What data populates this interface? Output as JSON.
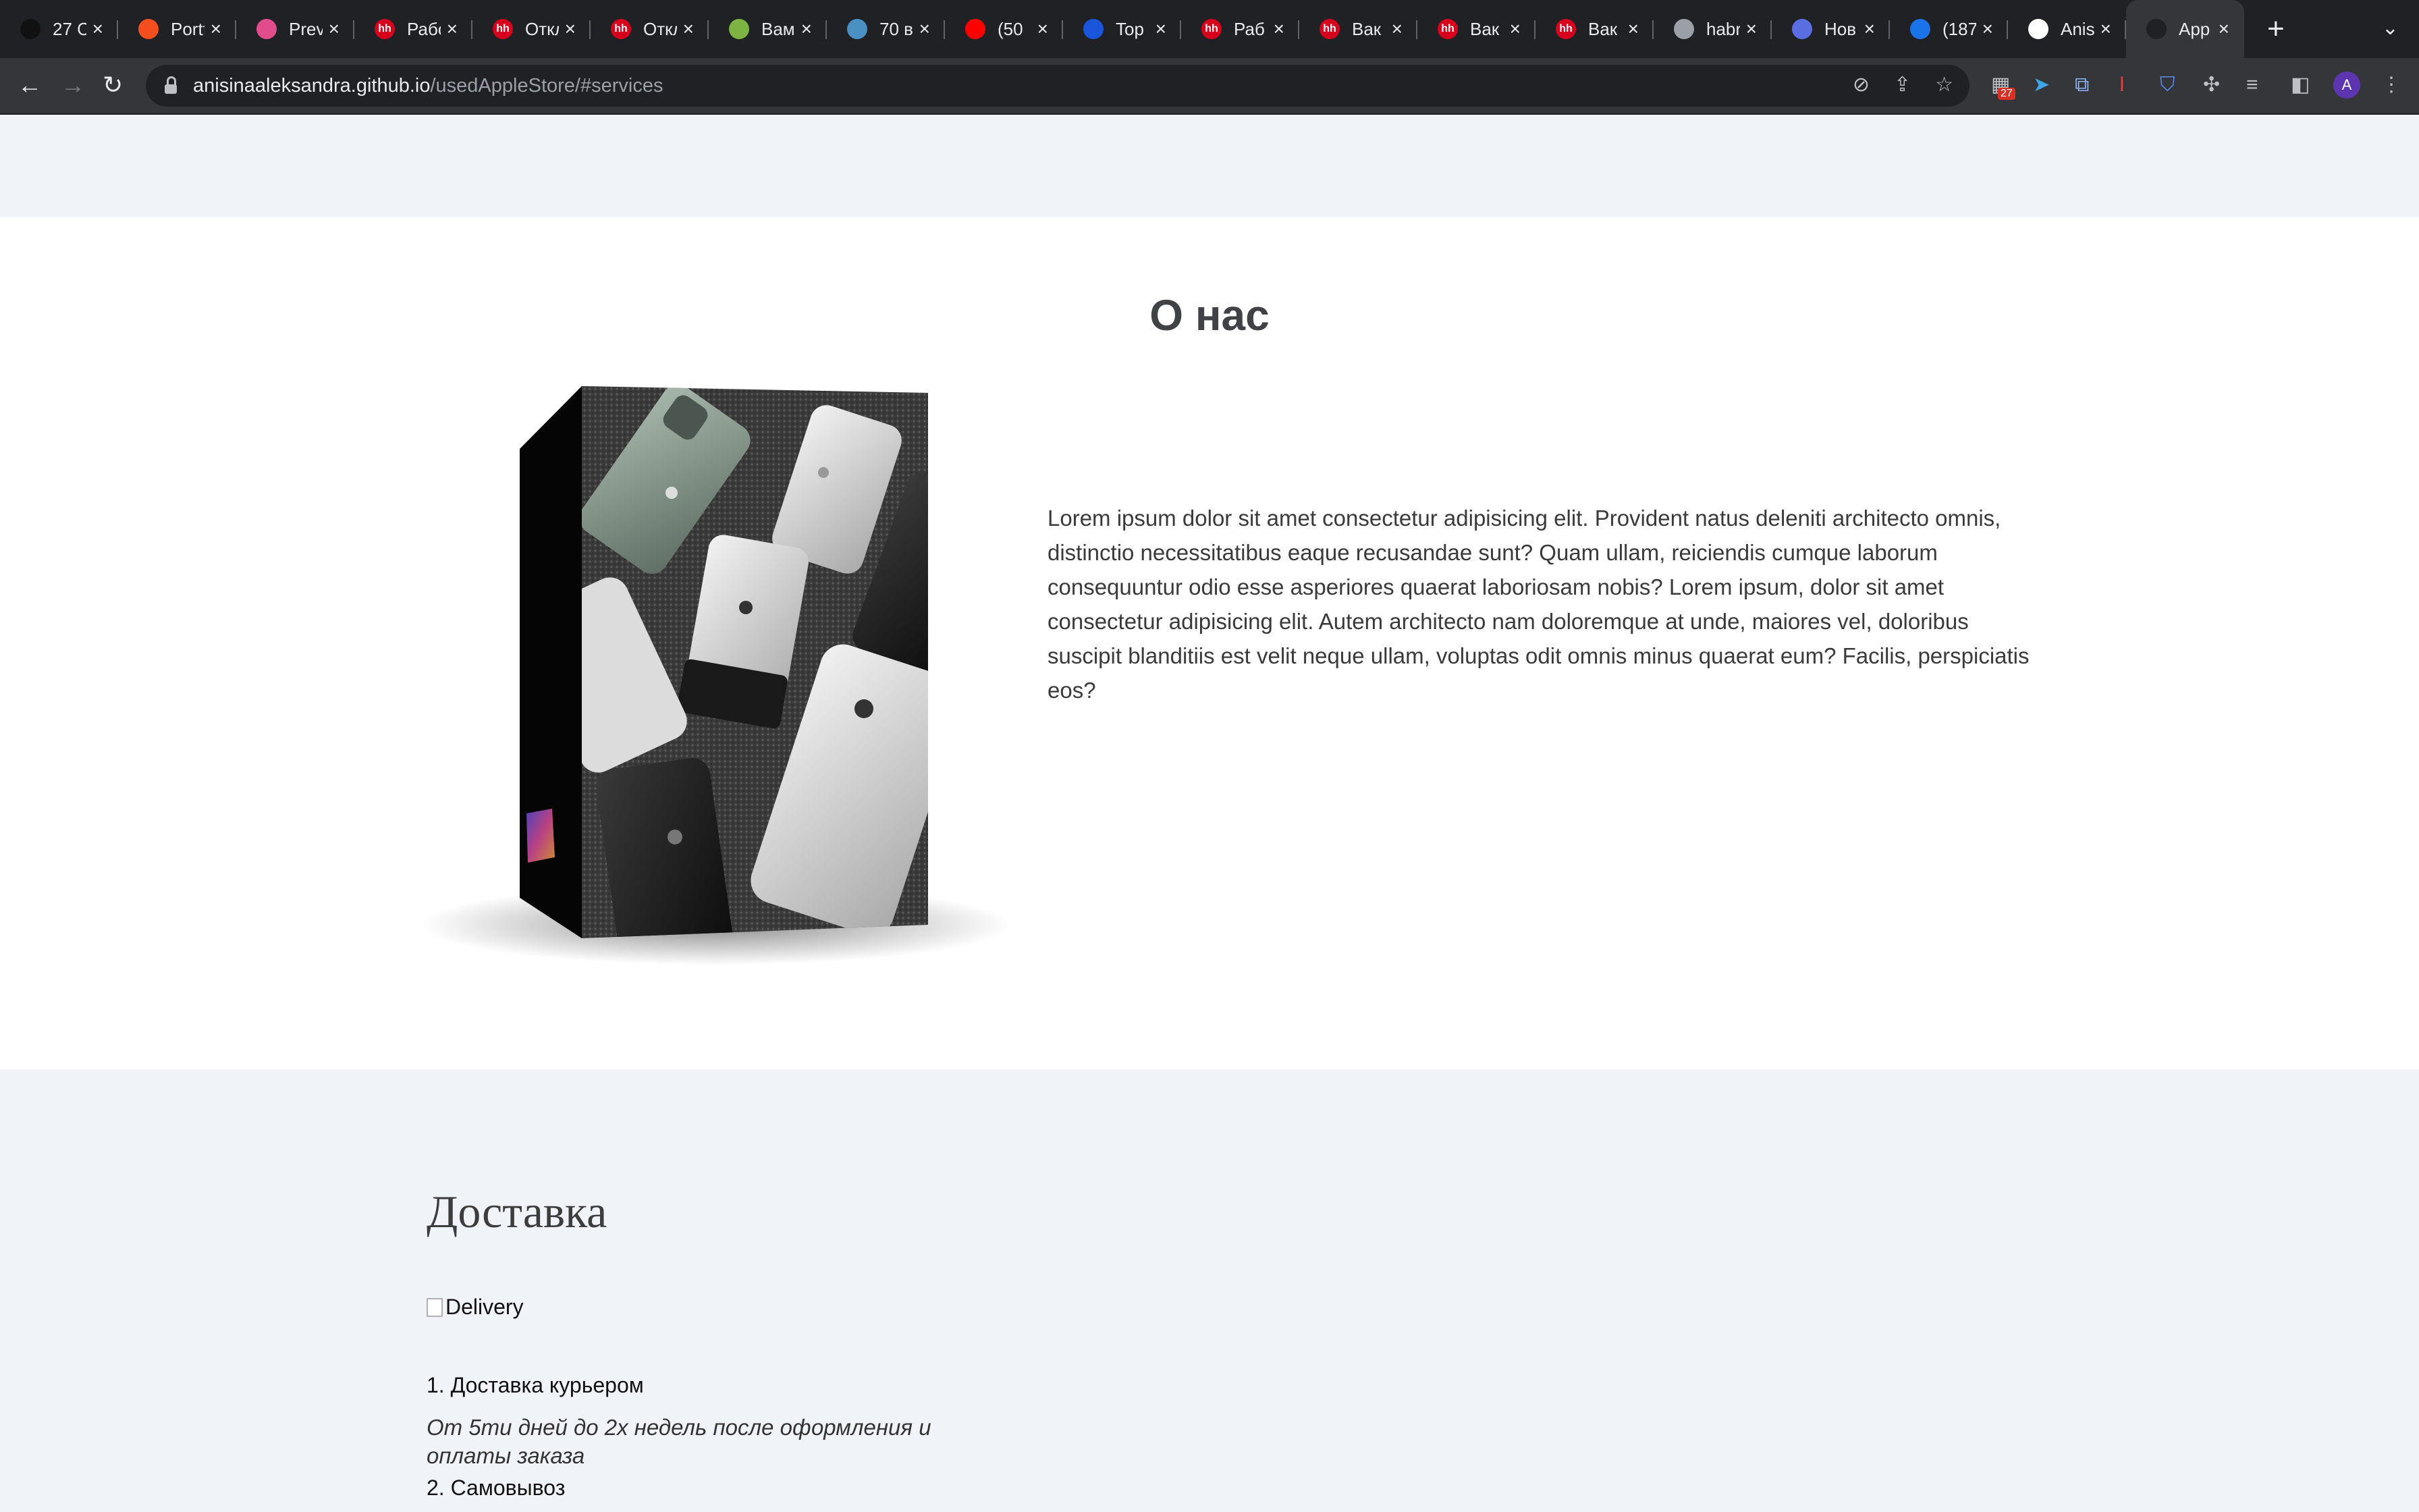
{
  "browser": {
    "tabs": [
      {
        "title": "27 C",
        "icon": "dark-avatar-icon",
        "color": "#111111"
      },
      {
        "title": "Portf",
        "icon": "figma-icon",
        "color": "#f24e1e"
      },
      {
        "title": "Prev",
        "icon": "s-logo-icon",
        "color": "#e04c8c"
      },
      {
        "title": "Рабо",
        "icon": "hh-icon",
        "color": "#d6001c"
      },
      {
        "title": "Откл",
        "icon": "hh-icon",
        "color": "#d6001c"
      },
      {
        "title": "Откл",
        "icon": "hh-icon",
        "color": "#d6001c"
      },
      {
        "title": "Вами",
        "icon": "green-logo-icon",
        "color": "#7cb342"
      },
      {
        "title": "70 в",
        "icon": "image-icon",
        "color": "#4a90c2"
      },
      {
        "title": "(50",
        "icon": "youtube-icon",
        "color": "#ff0000"
      },
      {
        "title": "Top",
        "icon": "blue-logo-icon",
        "color": "#1a56db"
      },
      {
        "title": "Раб",
        "icon": "hh-icon",
        "color": "#d6001c"
      },
      {
        "title": "Вак",
        "icon": "hh-icon",
        "color": "#d6001c"
      },
      {
        "title": "Вак",
        "icon": "hh-icon",
        "color": "#d6001c"
      },
      {
        "title": "Вак",
        "icon": "hh-icon",
        "color": "#d6001c"
      },
      {
        "title": "habr",
        "icon": "globe-icon",
        "color": "#9aa0a6"
      },
      {
        "title": "Нов",
        "icon": "circle-logo-icon",
        "color": "#5b6ee1"
      },
      {
        "title": "(187",
        "icon": "mail-icon",
        "color": "#1a73e8"
      },
      {
        "title": "Anis",
        "icon": "github-icon",
        "color": "#ffffff"
      },
      {
        "title": "App",
        "icon": "a-logo-icon",
        "color": "#202124",
        "active": true
      }
    ],
    "url_host": "anisinaaleksandra.github.io",
    "url_path": "/usedAppleStore/#services",
    "extension_badge": "27",
    "avatar_letter": "A"
  },
  "about": {
    "title": "О нас",
    "text": "Lorem ipsum dolor sit amet consectetur adipisicing elit. Provident natus deleniti architecto omnis, distinctio necessitatibus eaque recusandae sunt? Quam ullam, reiciendis cumque laborum consequuntur odio esse asperiores quaerat laboriosam nobis? Lorem ipsum, dolor sit amet consectetur adipisicing elit. Autem architecto nam doloremque at unde, maiores vel, doloribus suscipit blanditiis est velit neque ullam, voluptas odit omnis minus quaerat eum? Facilis, perspiciatis eos?"
  },
  "delivery": {
    "title": "Доставка",
    "image_alt": "Delivery",
    "item1": "1. Доставка курьером",
    "item1_desc": "От 5ти дней до 2х недель после оформления и оплаты заказа",
    "item2": "2. Самовывоз"
  },
  "colors": {
    "page_bg": "#f0f4f8",
    "section_bg": "#ffffff",
    "chrome_dark": "#202124",
    "chrome_toolbar": "#35363a"
  }
}
